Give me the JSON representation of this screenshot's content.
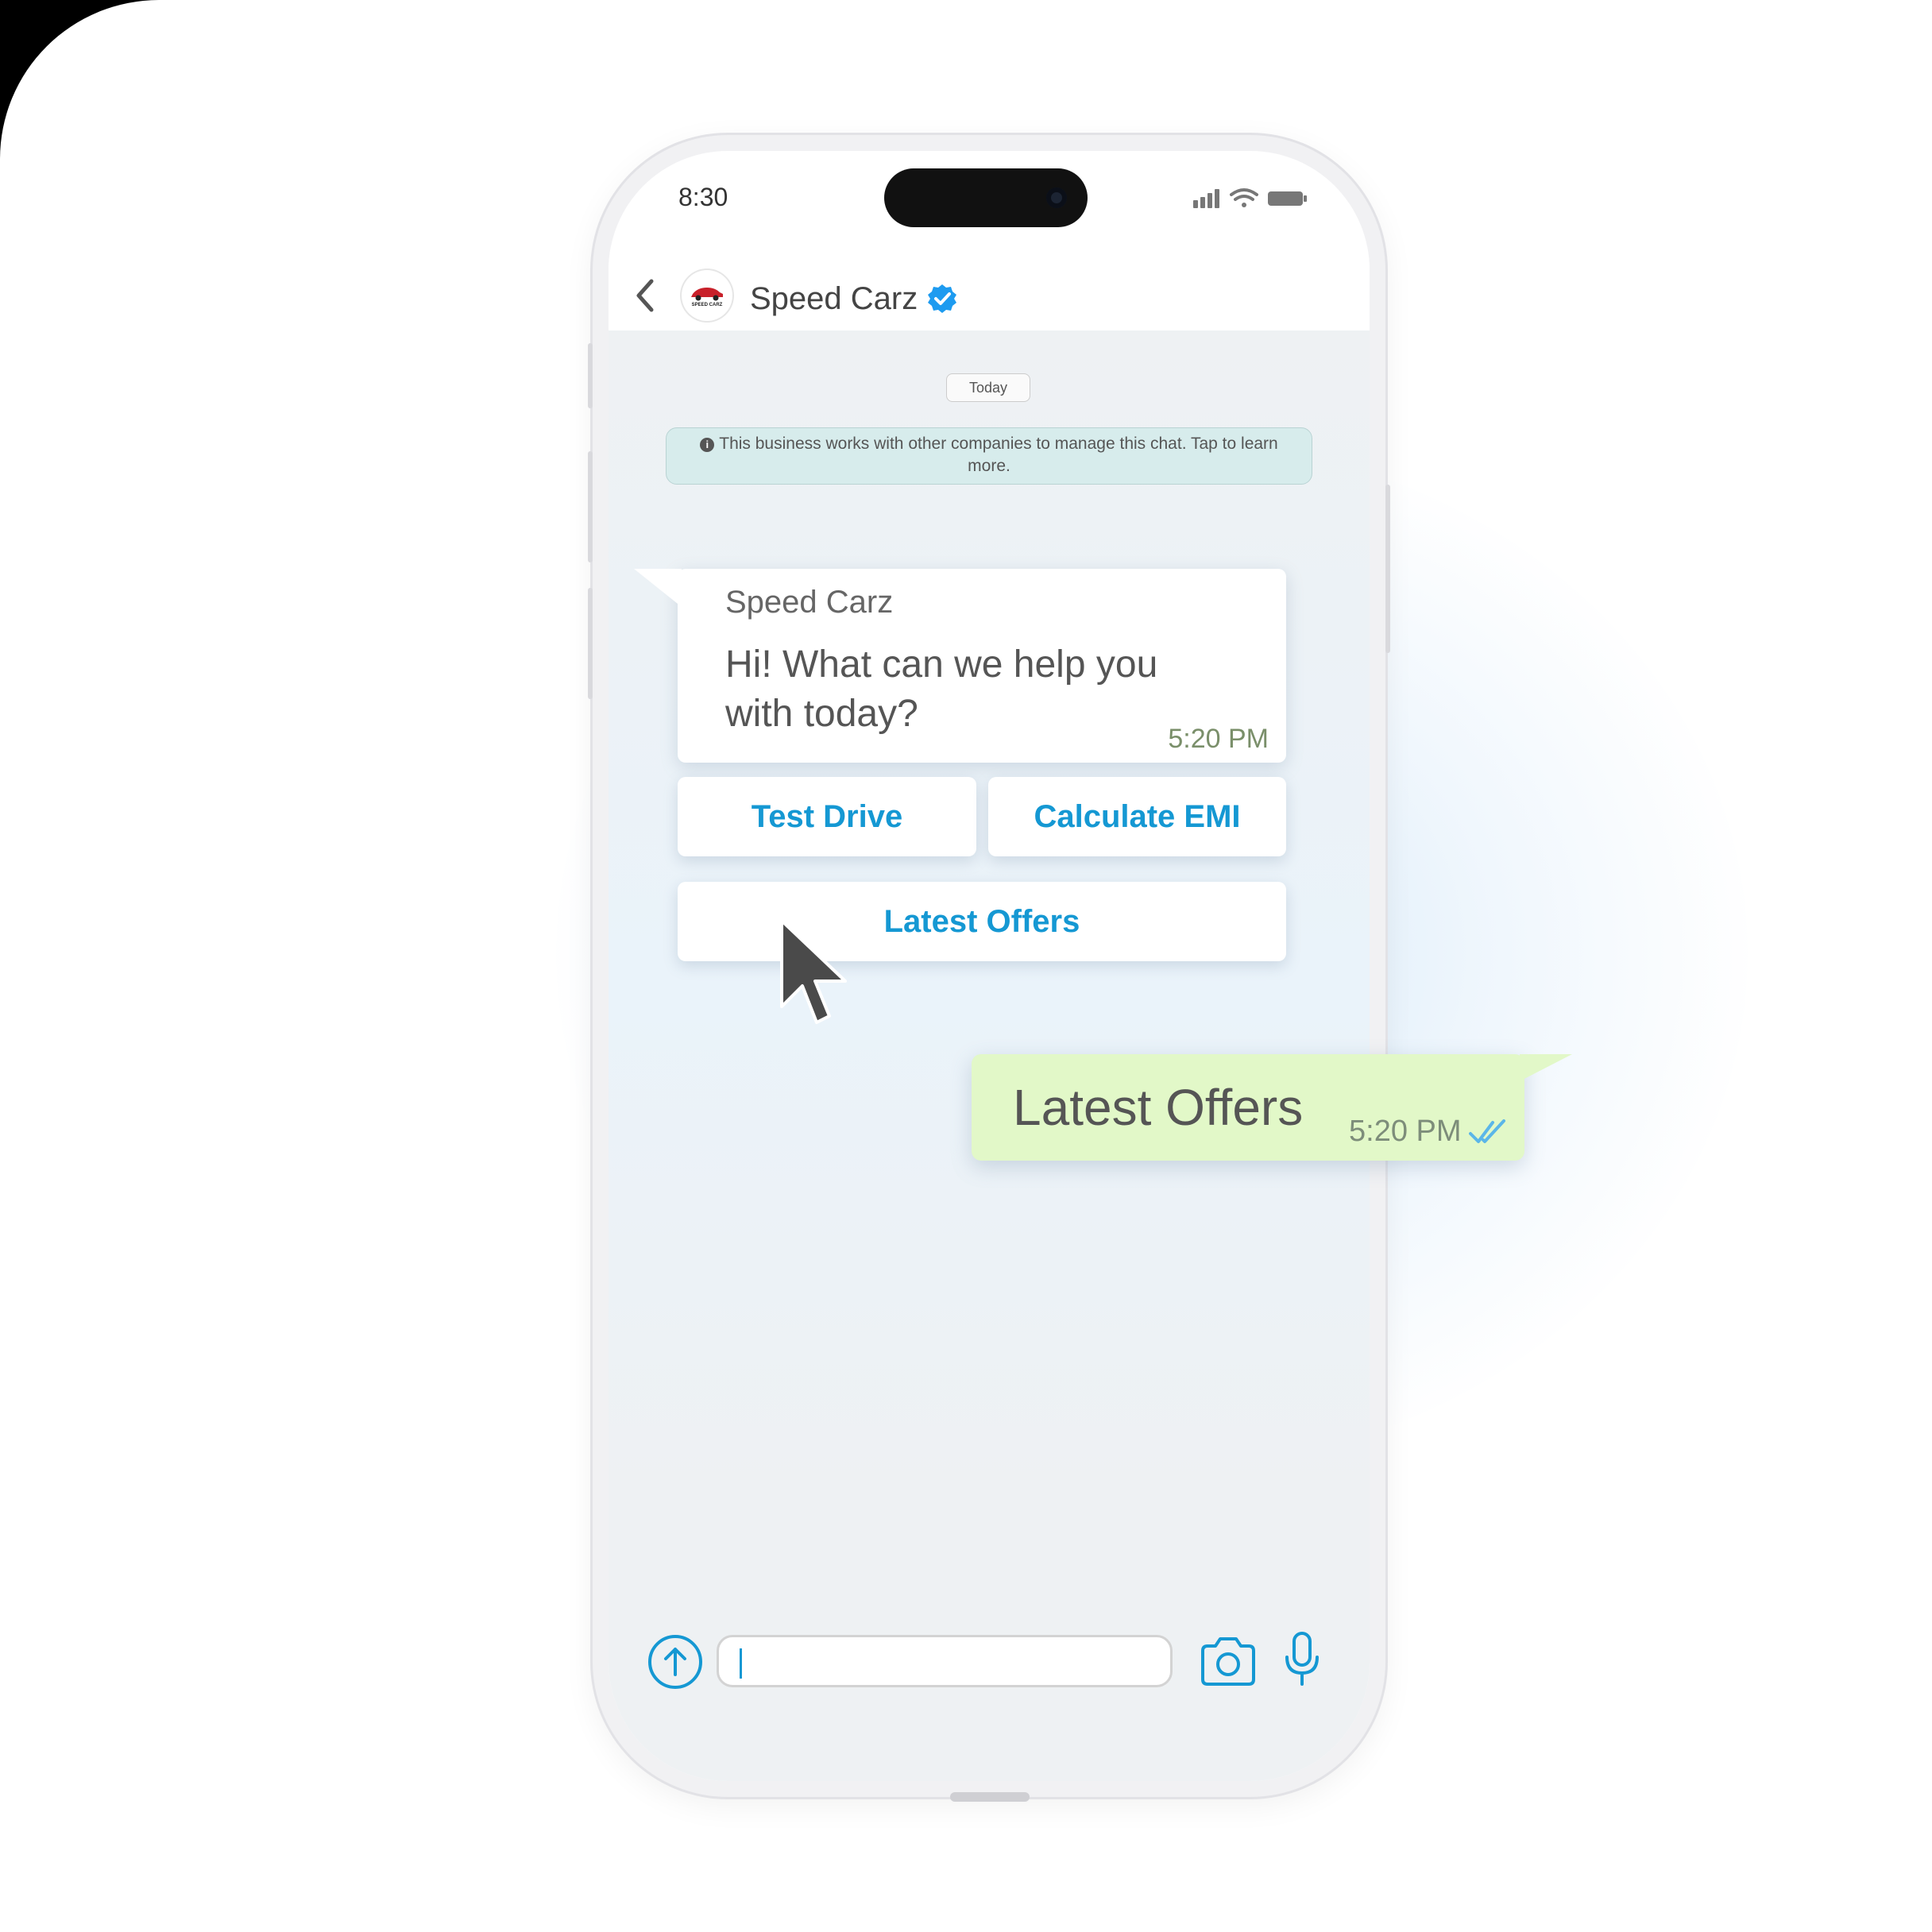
{
  "status_bar": {
    "time": "8:30"
  },
  "header": {
    "contact_name": "Speed Carz",
    "avatar_logo_text": "SPEED CARZ"
  },
  "chat": {
    "day_label": "Today",
    "business_notice": "This business works with other companies to manage this chat. Tap to learn more.",
    "incoming_message": {
      "sender": "Speed Carz",
      "text": "Hi! What can we help you with today?",
      "time": "5:20 PM"
    },
    "quick_replies": [
      {
        "label": "Test Drive"
      },
      {
        "label": "Calculate EMI"
      },
      {
        "label": "Latest Offers"
      }
    ],
    "outgoing_message": {
      "text": "Latest Offers",
      "time": "5:20 PM",
      "status": "read"
    }
  },
  "input": {
    "value": "",
    "placeholder": ""
  },
  "colors": {
    "accent": "#1598d3",
    "outgoing_bubble": "#e2f8c8",
    "incoming_bubble": "#ffffff",
    "verified": "#1d9bf0",
    "notice_bg": "#d7ecec"
  },
  "icons": [
    "back-icon",
    "verified-icon",
    "info-icon",
    "plus-icon",
    "camera-icon",
    "mic-icon",
    "read-ticks-icon",
    "cursor-icon",
    "signal-icon",
    "wifi-icon",
    "battery-icon"
  ]
}
